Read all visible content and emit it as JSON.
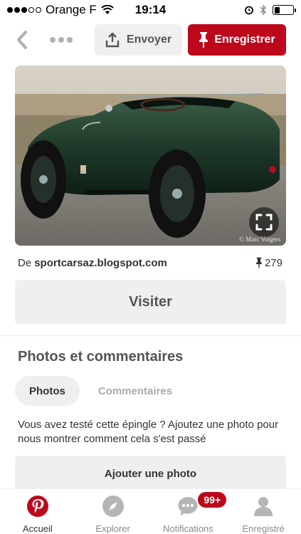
{
  "status_bar": {
    "carrier": "Orange F",
    "time": "19:14"
  },
  "toolbar": {
    "send_label": "Envoyer",
    "save_label": "Enregistrer"
  },
  "pin": {
    "watermark": "© Marc Vorgers",
    "source_prefix": "De",
    "source_domain": "sportcarsaz.blogspot.com",
    "repin_count": "279",
    "visit_label": "Visiter"
  },
  "photos_section": {
    "title": "Photos et commentaires",
    "tabs": [
      {
        "label": "Photos",
        "active": true
      },
      {
        "label": "Commentaires",
        "active": false
      }
    ],
    "description": "Vous avez testé cette épingle ? Ajoutez une photo pour nous montrer comment cela s'est passé",
    "add_photo_label": "Ajouter une photo"
  },
  "bottom_nav": {
    "items": [
      {
        "label": "Accueil",
        "icon": "pinterest-logo-icon",
        "active": true
      },
      {
        "label": "Explorer",
        "icon": "compass-icon",
        "active": false
      },
      {
        "label": "Notifications",
        "icon": "chat-bubble-icon",
        "active": false,
        "badge": "99+"
      },
      {
        "label": "Enregistré",
        "icon": "profile-icon",
        "active": false
      }
    ]
  },
  "colors": {
    "brand_red": "#bd081c",
    "button_gray": "#efefef",
    "car_green": "#1f3a2a"
  }
}
